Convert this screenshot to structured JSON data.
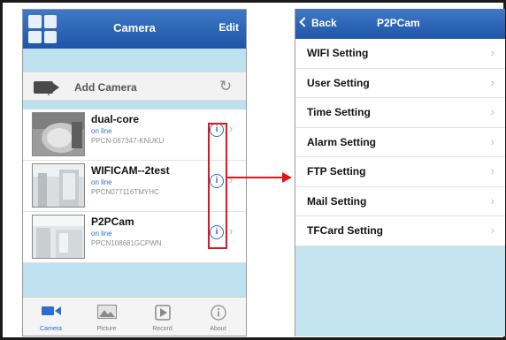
{
  "left_screen": {
    "navbar": {
      "title": "Camera",
      "edit_label": "Edit"
    },
    "add_camera": {
      "label": "Add Camera"
    },
    "cameras": [
      {
        "name": "dual-core",
        "status": "on line",
        "uid": "PPCN-067347-KNUKU"
      },
      {
        "name": "WIFICAM--2test",
        "status": "on line",
        "uid": "PPCN077116TMYHC"
      },
      {
        "name": "P2PCam",
        "status": "on line",
        "uid": "PPCN108681GCPWN"
      }
    ],
    "info_glyph": "i",
    "tabs": [
      {
        "label": "Camera",
        "icon": "video-camera-icon",
        "active": true
      },
      {
        "label": "Picture",
        "icon": "picture-icon",
        "active": false
      },
      {
        "label": "Record",
        "icon": "record-icon",
        "active": false
      },
      {
        "label": "About",
        "icon": "info-icon",
        "active": false
      }
    ]
  },
  "right_screen": {
    "navbar": {
      "back_label": "Back",
      "title": "P2PCam"
    },
    "settings": [
      {
        "label": "WIFI Setting"
      },
      {
        "label": "User Setting"
      },
      {
        "label": "Time Setting"
      },
      {
        "label": "Alarm Setting"
      },
      {
        "label": "FTP Setting"
      },
      {
        "label": "Mail Setting"
      },
      {
        "label": "TFCard Setting"
      }
    ]
  },
  "colors": {
    "navbar_blue": "#2a62b5",
    "light_blue_band": "#bfe0ee",
    "status_blue": "#2a6fd0",
    "annotation_red": "#e0141b"
  }
}
